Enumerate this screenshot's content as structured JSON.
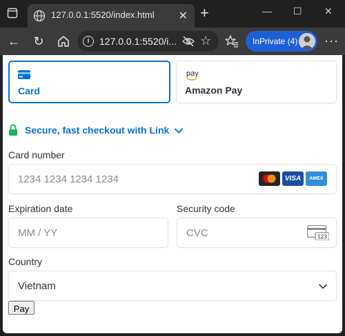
{
  "browser": {
    "tab": {
      "title": "127.0.0.1:5520/index.html"
    },
    "address": {
      "url": "127.0.0.1:5520/i..."
    },
    "profile": {
      "label": "InPrivate (4)"
    },
    "colors": {
      "accent": "#1f5fd6",
      "tab_bg": "#3b3b3b",
      "frame_bg": "#202020"
    }
  },
  "checkout": {
    "payment_methods": [
      {
        "label": "Card",
        "icon": "credit-card-icon",
        "selected": true
      },
      {
        "label": "Amazon Pay",
        "icon": "amazon-pay-icon",
        "selected": false
      }
    ],
    "amazon_pay_mark": "pay",
    "link": {
      "text": "Secure, fast checkout with Link",
      "icon": "lock-icon"
    },
    "card_number": {
      "label": "Card number",
      "placeholder": "1234 1234 1234 1234",
      "brands": [
        "mastercard",
        "visa",
        "amex"
      ],
      "visa_text": "VISA",
      "amex_text": "AMEX"
    },
    "expiration": {
      "label": "Expiration date",
      "placeholder": "MM / YY"
    },
    "security_code": {
      "label": "Security code",
      "placeholder": "CVC",
      "icon_text": "123"
    },
    "country": {
      "label": "Country",
      "value": "Vietnam"
    },
    "pay_button": {
      "label": "Pay"
    },
    "colors": {
      "primary": "#0570de",
      "link_lock": "#20b35a",
      "text": "#30313d",
      "placeholder": "#8a8a8a"
    }
  }
}
